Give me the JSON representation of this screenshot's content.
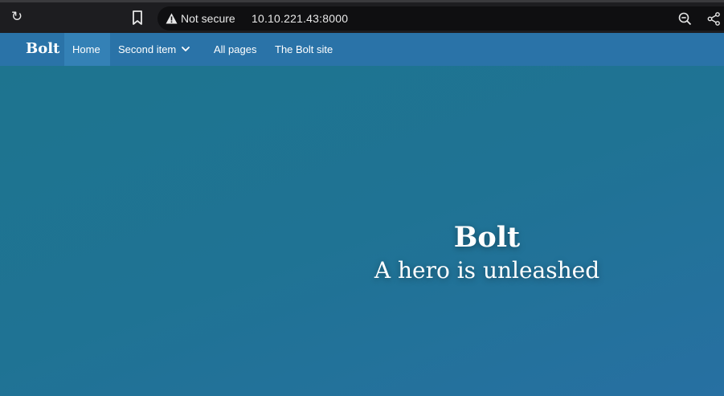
{
  "browser": {
    "security_label": "Not secure",
    "url": "10.10.221.43:8000",
    "icons": [
      "reload-icon",
      "bookmark-icon",
      "warning-icon",
      "zoom-out-icon",
      "share-icon"
    ]
  },
  "navbar": {
    "brand": "Bolt",
    "items": [
      {
        "label": "Home",
        "active": true
      },
      {
        "label": "Second item",
        "has_dropdown": true
      },
      {
        "label": "All pages"
      },
      {
        "label": "The Bolt site"
      }
    ]
  },
  "hero": {
    "title": "Bolt",
    "subtitle": "A hero is unleashed"
  },
  "colors": {
    "chrome_bg": "#1d1d20",
    "omnibox_bg": "#0f0f11",
    "navbar_bg": "#2a73a8",
    "nav_active_bg": "#3481b6",
    "hero_bg": "#1f7494",
    "text": "#ffffff"
  }
}
